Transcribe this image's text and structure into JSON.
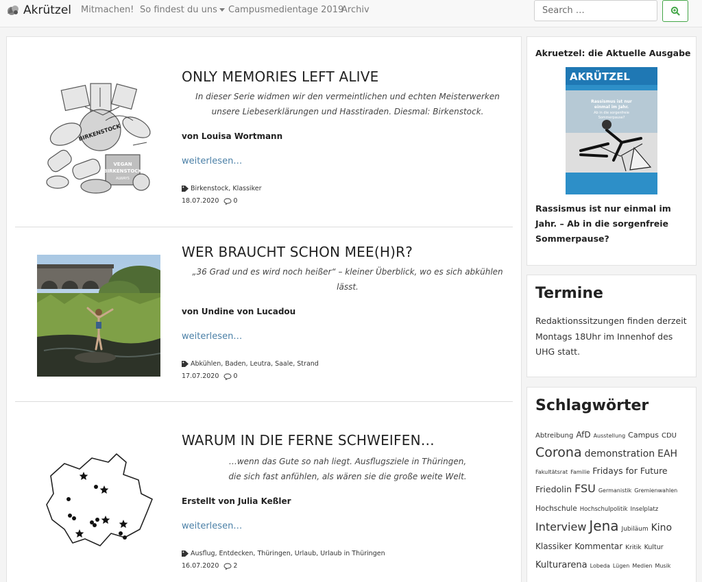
{
  "nav": {
    "brand": "Akrützel",
    "items": [
      {
        "label": "Mitmachen!"
      },
      {
        "label": "So findest du uns",
        "dropdown": true
      },
      {
        "label": "Campusmedientage 2019"
      },
      {
        "label": "Archiv"
      }
    ],
    "search_placeholder": "Search …",
    "search_icon": "search-icon",
    "accent": "#43a647"
  },
  "posts": [
    {
      "title": "ONLY MEMORIES LEFT ALIVE",
      "excerpt_lines": [
        "In dieser Serie widmen wir den vermeintlichen und echten Meisterwerken",
        "unsere Liebeserklärungen und Hasstiraden. Diesmal: Birkenstock."
      ],
      "author": "von Louisa Wortmann",
      "more": "weiterlesen…",
      "tags": "Birkenstock, Klassiker",
      "date": "18.07.2020",
      "comments": "0",
      "thumb_labels": [
        "BIRKENSTOCK",
        "VEGAN",
        "BIRKENSTOCK",
        "ALWAYS"
      ]
    },
    {
      "title": "WER BRAUCHT SCHON MEE(H)R?",
      "excerpt_lines": [
        "„36 Grad und es wird noch heißer“ – kleiner Überblick, wo es sich abkühlen lässt."
      ],
      "author": "von Undine von Lucadou",
      "more": "weiterlesen…",
      "tags": "Abkühlen, Baden, Leutra, Saale, Strand",
      "date": "17.07.2020",
      "comments": "0"
    },
    {
      "title": "WARUM IN DIE FERNE SCHWEIFEN…",
      "excerpt_lines": [
        "…wenn das Gute so nah liegt. Ausflugsziele in Thüringen,",
        "die sich fast anfühlen, als wären sie die große weite Welt."
      ],
      "author": "Erstellt von Julia Keßler",
      "more": "weiterlesen…",
      "tags": "Ausflug, Entdecken, Thüringen, Urlaub, Urlaub in Thüringen",
      "date": "16.07.2020",
      "comments": "2"
    }
  ],
  "sidebar": {
    "issue": {
      "title": "Akruetzel: die Aktuelle Ausgabe",
      "cover_brand": "AKRÜTZEL",
      "cover_headline": [
        "Rassismus ist nur",
        "einmal im Jahr.",
        "Ab in die sorgenfreie",
        "Sommerpause?"
      ],
      "headline": "Rassismus ist nur einmal im Jahr. – Ab in die sorgenfreie Sommerpause?"
    },
    "termine": {
      "title": "Termine",
      "text": "Redaktionssitzungen finden derzeit Montags 18Uhr im Innenhof des UHG statt."
    },
    "tags": {
      "title": "Schlagwörter",
      "items": [
        {
          "t": "Abtreibung",
          "s": 10
        },
        {
          "t": "AfD",
          "s": 12
        },
        {
          "t": "Ausstellung",
          "s": 8
        },
        {
          "t": "Campus",
          "s": 11
        },
        {
          "t": "CDU",
          "s": 10
        },
        {
          "t": "Corona",
          "s": 19
        },
        {
          "t": "demonstration",
          "s": 14
        },
        {
          "t": "EAH",
          "s": 14
        },
        {
          "t": "Fakultätsrat",
          "s": 8
        },
        {
          "t": "Familie",
          "s": 8
        },
        {
          "t": "Fridays for Future",
          "s": 12.5
        },
        {
          "t": "Friedolin",
          "s": 12.5
        },
        {
          "t": "FSU",
          "s": 16
        },
        {
          "t": "Germanistik",
          "s": 8
        },
        {
          "t": "Gremienwahlen",
          "s": 8
        },
        {
          "t": "Hochschule",
          "s": 10.5
        },
        {
          "t": "Hochschulpolitik",
          "s": 8.5
        },
        {
          "t": "Inselplatz",
          "s": 8.5
        },
        {
          "t": "Interview",
          "s": 16
        },
        {
          "t": "Jena",
          "s": 20
        },
        {
          "t": "Jubiläum",
          "s": 9
        },
        {
          "t": "Kino",
          "s": 14
        },
        {
          "t": "Klassiker",
          "s": 12
        },
        {
          "t": "Kommentar",
          "s": 12
        },
        {
          "t": "Kritik",
          "s": 9
        },
        {
          "t": "Kultur",
          "s": 9.5
        },
        {
          "t": "Kulturarena",
          "s": 13
        },
        {
          "t": "Lobeda",
          "s": 8
        },
        {
          "t": "Lügen",
          "s": 8
        },
        {
          "t": "Medien",
          "s": 8
        },
        {
          "t": "Musik",
          "s": 8
        }
      ]
    }
  }
}
